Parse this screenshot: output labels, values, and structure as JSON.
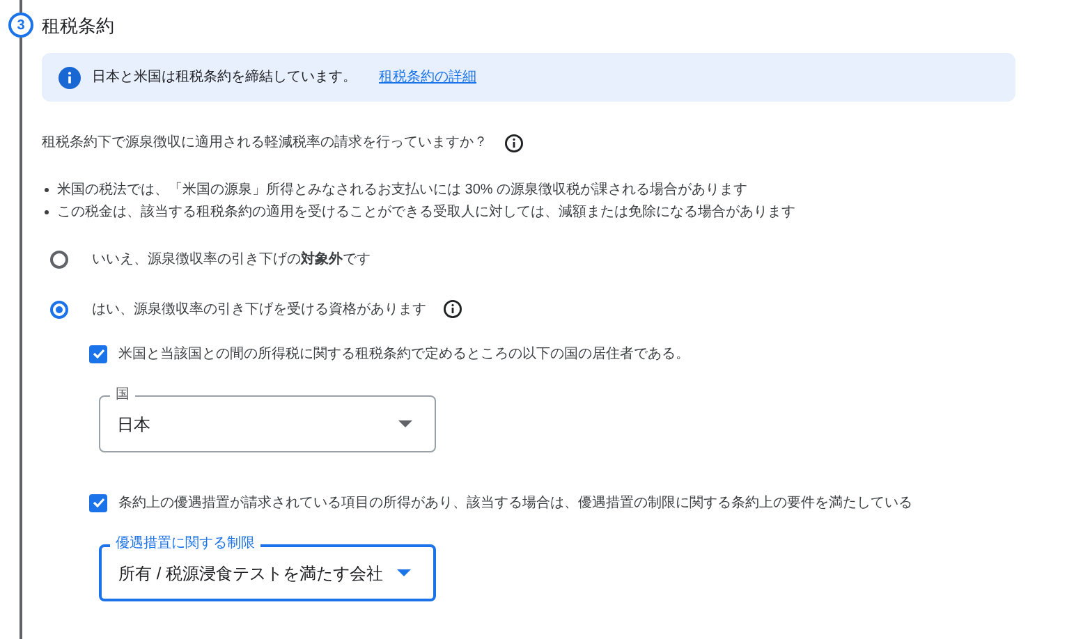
{
  "step": {
    "number": "3",
    "title": "租税条約"
  },
  "banner": {
    "text": "日本と米国は租税条約を締結しています。",
    "link": "租税条約の詳細"
  },
  "question": {
    "text": "租税条約下で源泉徴収に適用される軽減税率の請求を行っていますか？",
    "info": true
  },
  "bullets": [
    "米国の税法では、「米国の源泉」所得とみなされるお支払いには 30% の源泉徴収税が課される場合があります",
    "この税金は、該当する租税条約の適用を受けることができる受取人に対しては、減額または免除になる場合があります"
  ],
  "options": [
    {
      "label": "いいえ、源泉徴収率の引き下げの**対象外**です",
      "selected": false,
      "info": false
    },
    {
      "label": "はい、源泉徴収率の引き下げを受ける資格があります",
      "selected": true,
      "info": true
    }
  ],
  "conditions": [
    {
      "label": "米国と当該国との間の所得税に関する租税条約で定めるところの以下の国の居住者である。",
      "checked": true,
      "select": {
        "label": "国",
        "value": "日本",
        "focused": false
      }
    },
    {
      "label": "条約上の優遇措置が請求されている項目の所得があり、該当する場合は、優遇措置の制限に関する条約上の要件を満たしている",
      "checked": true,
      "select": {
        "label": "優遇措置に関する制限",
        "value": "所有 / 税源浸食テストを満たす会社",
        "focused": true
      }
    }
  ]
}
